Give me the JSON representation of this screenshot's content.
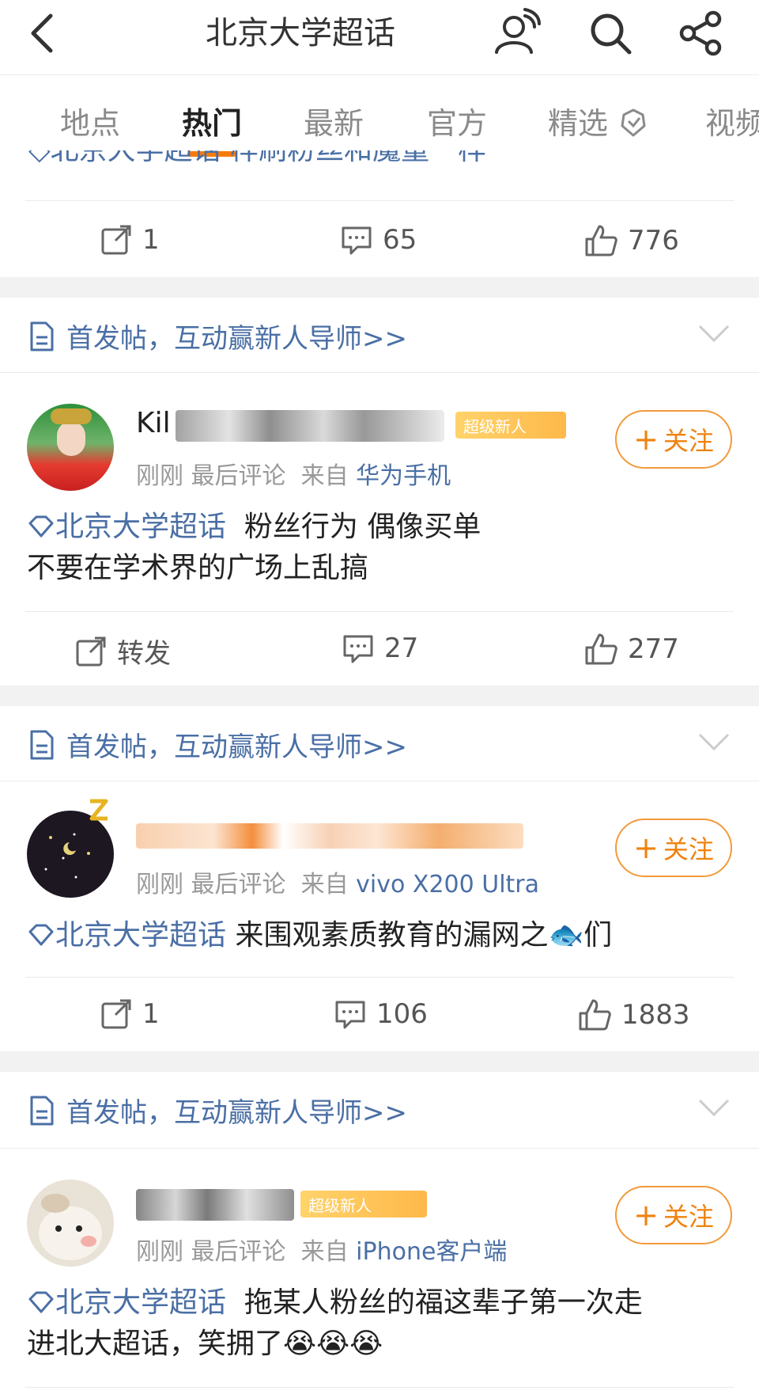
{
  "header": {
    "title": "北京大学超话"
  },
  "tabs": [
    {
      "label": "地点",
      "active": false
    },
    {
      "label": "热门",
      "active": true
    },
    {
      "label": "最新",
      "active": false
    },
    {
      "label": "官方",
      "active": false
    },
    {
      "label": "精选",
      "active": false
    },
    {
      "label": "视频",
      "active": false
    }
  ],
  "top_partial": {
    "text": "◇北京大学超话 样刷粉丝和魔童一样",
    "repost": "1",
    "comments": "65",
    "likes": "776"
  },
  "notice": "首发帖，互动赢新人导师>>",
  "follow_label": "关注",
  "posts": [
    {
      "meta_prefix": "刚刚 最后评论",
      "source_label": "来自",
      "source": "华为手机",
      "name_visible": "Kil",
      "badge": "超级新人",
      "topic": "北京大学超话",
      "text_line1": "粉丝行为  偶像买单",
      "text_line2": "不要在学术界的广场上乱搞",
      "repost": "转发",
      "comments": "27",
      "likes": "277"
    },
    {
      "meta_prefix": "刚刚 最后评论",
      "source_label": "来自",
      "source": "vivo X200 Ultra",
      "topic": "北京大学超话",
      "text_line1": "来围观素质教育的漏网之🐟们",
      "repost": "1",
      "comments": "106",
      "likes": "1883"
    },
    {
      "meta_prefix": "刚刚 最后评论",
      "source_label": "来自",
      "source": "iPhone客户端",
      "badge": "超级新人",
      "topic": "北京大学超话",
      "text_line1": "拖某人粉丝的福这辈子第一次走",
      "text_line2": "进北大超话，笑拥了😭😭😭"
    }
  ],
  "colors": {
    "accent": "#f77b0c",
    "link": "#4a6fa5",
    "follow_border": "#f29a3b"
  }
}
